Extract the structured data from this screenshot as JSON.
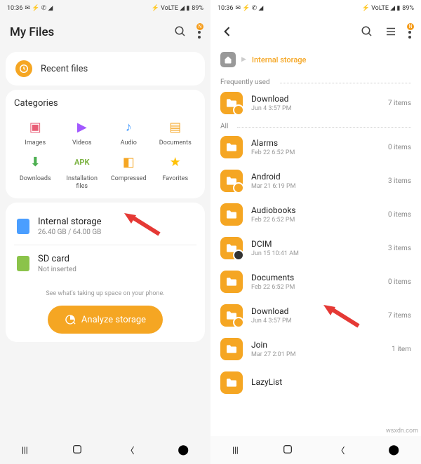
{
  "left": {
    "status": {
      "time": "10:36",
      "battery": "89%"
    },
    "title": "My Files",
    "recent": "Recent files",
    "categories_title": "Categories",
    "categories": [
      {
        "label": "Images"
      },
      {
        "label": "Videos"
      },
      {
        "label": "Audio"
      },
      {
        "label": "Documents"
      },
      {
        "label": "Downloads"
      },
      {
        "label": "Installation files"
      },
      {
        "label": "Compressed"
      },
      {
        "label": "Favorites"
      }
    ],
    "storage": {
      "internal": {
        "name": "Internal storage",
        "sub": "26.40 GB / 64.00 GB"
      },
      "sd": {
        "name": "SD card",
        "sub": "Not inserted"
      }
    },
    "taking_up": "See what's taking up space on your phone.",
    "analyze": "Analyze storage"
  },
  "right": {
    "status": {
      "time": "10:36",
      "battery": "89%"
    },
    "breadcrumb": "Internal storage",
    "freq_label": "Frequently used",
    "all_label": "All",
    "freq": [
      {
        "name": "Download",
        "date": "Jun 4 3:57 PM",
        "count": "7 items"
      }
    ],
    "folders": [
      {
        "name": "Alarms",
        "date": "Feb 22 6:52 PM",
        "count": "0 items"
      },
      {
        "name": "Android",
        "date": "Mar 21 6:19 PM",
        "count": "3 items"
      },
      {
        "name": "Audiobooks",
        "date": "Feb 22 6:52 PM",
        "count": "0 items"
      },
      {
        "name": "DCIM",
        "date": "Jun 15 10:41 AM",
        "count": "3 items"
      },
      {
        "name": "Documents",
        "date": "Feb 22 6:52 PM",
        "count": "0 items"
      },
      {
        "name": "Download",
        "date": "Jun 4 3:57 PM",
        "count": "7 items"
      },
      {
        "name": "Join",
        "date": "Mar 27 2:01 PM",
        "count": "1 item"
      },
      {
        "name": "LazyList",
        "date": "",
        "count": ""
      }
    ]
  },
  "watermark": "wsxdn.com"
}
